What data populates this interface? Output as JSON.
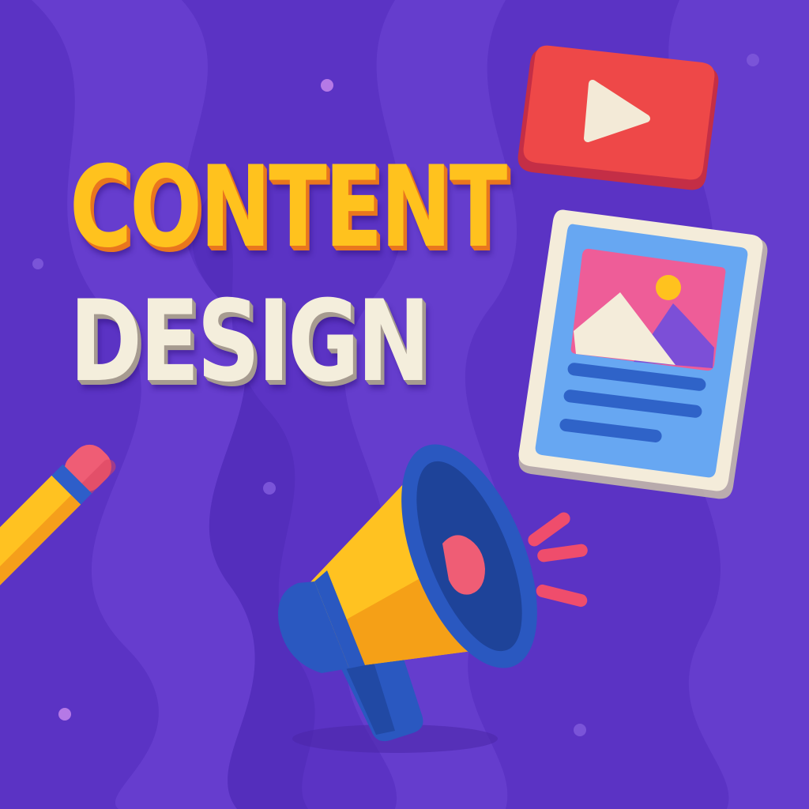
{
  "headline": {
    "line1": "CONTENT",
    "line2": "DESIGN"
  },
  "colors": {
    "background": "#5B33C4",
    "wave_light": "#6A41D2",
    "headline_line1": "#FFC21E",
    "headline_line1_shadow": "#E9761E",
    "headline_line2": "#F4EEDC",
    "headline_line2_shadow": "#A69B90",
    "video_red": "#EE4848",
    "play_cream": "#F3EAD7",
    "card_frame": "#F4ECDA",
    "card_blue": "#67A7F2",
    "image_pink": "#EE5D98",
    "text_line_blue": "#2F63C8",
    "pencil_yellow": "#FFC221",
    "eraser_pink": "#EF5D75",
    "megaphone_blue": "#2A58C0",
    "accent_red": "#EF4D6C"
  },
  "icons": [
    "video-play-icon",
    "image-card-icon",
    "pencil-icon",
    "megaphone-icon"
  ]
}
